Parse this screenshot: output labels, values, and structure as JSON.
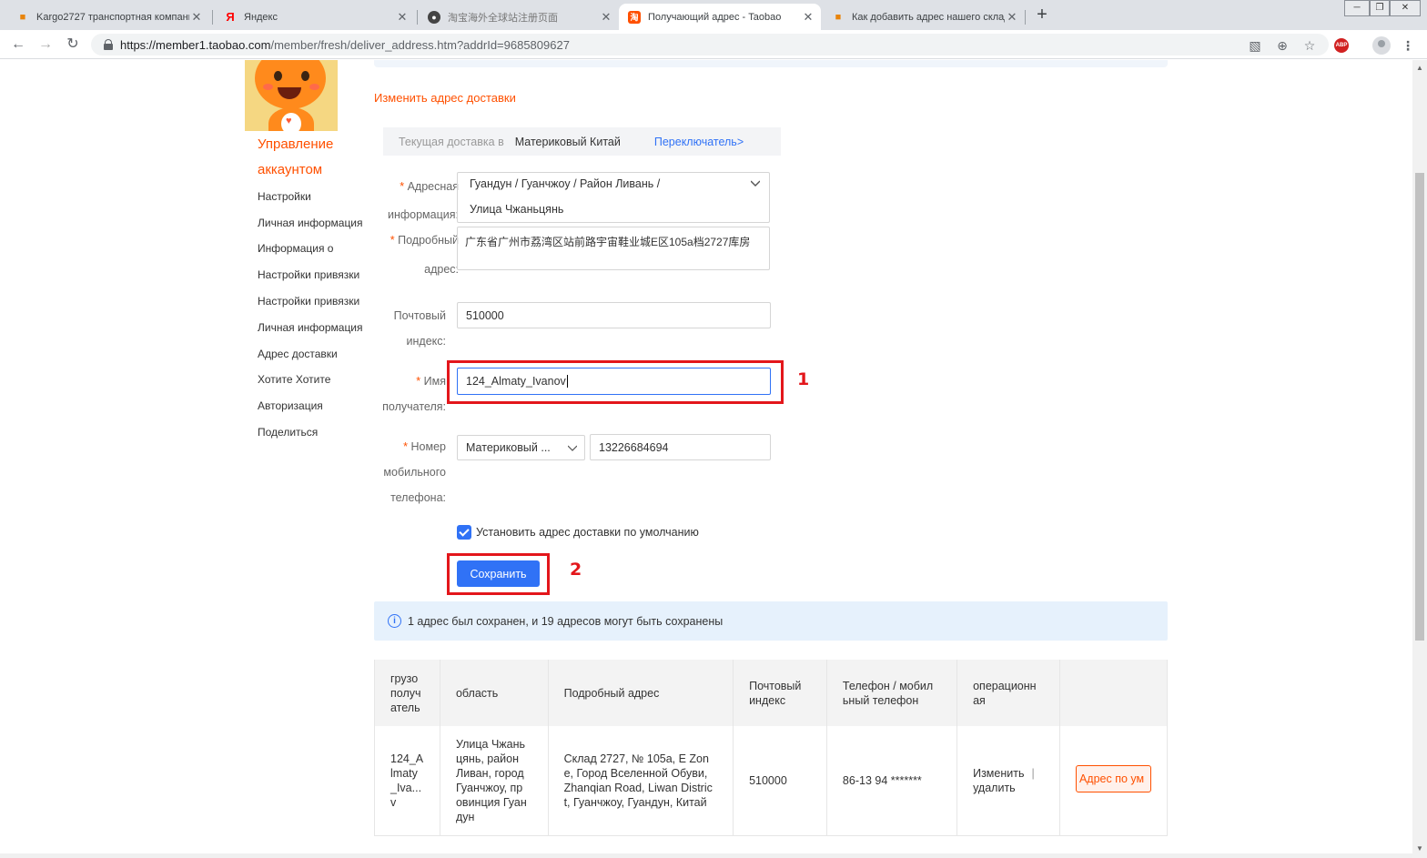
{
  "browser": {
    "tabs": [
      {
        "title": "Kargo2727 транспортная компания",
        "icon": "cargo-box-icon"
      },
      {
        "title": "Яндекс",
        "icon": "yandex-icon"
      },
      {
        "title": "淘宝海外全球站注册页面",
        "icon": "globe-icon"
      },
      {
        "title": "Получающий адрес - Taobao",
        "icon": "taobao-icon"
      },
      {
        "title": "Как добавить адрес нашего склада",
        "icon": "cargo-box-icon"
      }
    ],
    "url_host": "https://member1.taobao.com",
    "url_path": "/member/fresh/deliver_address.htm?addrId=9685809627"
  },
  "sidebar": {
    "title_line1": "Управление",
    "title_line2": "аккаунтом",
    "items": [
      "Настройки",
      "Личная информация",
      "Информация о",
      "Настройки привязки",
      "Настройки привязки",
      "Личная информация",
      "Адрес доставки",
      "Хотите Хотите",
      "Авторизация",
      "Поделиться"
    ]
  },
  "form": {
    "change_link": "Изменить адрес доставки",
    "current_delivery_label": "Текущая доставка в",
    "current_delivery_value": "Материковый Китай",
    "switch_label": "Переключатель>",
    "region_label_1": "Адресная",
    "region_label_2": "информация:",
    "region_line1": "Гуандун  /  Гуанчжоу  /   Район Ливань  /",
    "region_line2": "Улица Чжаньцянь",
    "detail_label_1": "Подробный",
    "detail_label_2": "адрес:",
    "detail_value": "广东省广州市荔湾区站前路宇宙鞋业城E区105a档2727库房",
    "postal_label_1": "Почтовый",
    "postal_label_2": "индекс:",
    "postal_value": "510000",
    "name_label_1": "Имя",
    "name_label_2": "получателя:",
    "name_value": "124_Almaty_Ivanov",
    "phone_label_1": "Номер",
    "phone_label_2": "мобильного",
    "phone_label_3": "телефона:",
    "phone_region": "Материковый ...",
    "phone_value": "13226684694",
    "required_mark": "*",
    "default_checkbox_label": "Установить адрес доставки по умолчанию",
    "save_label": "Сохранить"
  },
  "annotations": {
    "marker_1": "1",
    "marker_2": "2"
  },
  "info_message": "1 адрес был сохранен, и 19 адресов могут быть сохранены",
  "table": {
    "headers": [
      "грузо\nполуч\nатель",
      "область",
      "Подробный адрес",
      "Почтовый\nиндекс",
      "Телефон / мобил\nьный телефон",
      "операционн\nая",
      ""
    ],
    "rows": [
      {
        "recipient": "124_A\nlmaty\n_Iva...\nv",
        "region": "Улица Чжань\nцянь, район\nЛиван, город\nГуанчжоу, пр\nовинция Гуан\nдун",
        "address": "Склад 2727, № 105a, E Zon\ne, Город Вселенной Обуви,\nZhanqian Road, Liwan Distric\nt, Гуанчжоу, Гуандун, Китай",
        "postal": "510000",
        "phone": "86-13 94 *******",
        "edit": "Изменить",
        "separator": "|",
        "delete": "удалить",
        "default_btn": "Адрес по ум"
      }
    ]
  },
  "colors": {
    "accent_orange": "#ff5000",
    "primary_blue": "#3072f6",
    "highlight_red": "#e3161b"
  }
}
